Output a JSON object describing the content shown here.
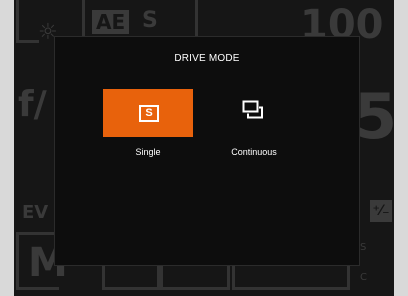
{
  "background": {
    "iso_value": "100",
    "aperture_prefix": "f/",
    "aperture_digit": "5",
    "ev_label": "EV",
    "mode_letter": "M",
    "drive_side_s": "S",
    "drive_side_c": "C"
  },
  "dialog": {
    "title": "DRIVE MODE",
    "options": [
      {
        "label": "Single",
        "icon": "single-shot-icon",
        "selected": true
      },
      {
        "label": "Continuous",
        "icon": "continuous-shot-icon",
        "selected": false
      }
    ]
  },
  "colors": {
    "accent": "#e8620c",
    "background": "#161616",
    "text": "#ffffff"
  }
}
